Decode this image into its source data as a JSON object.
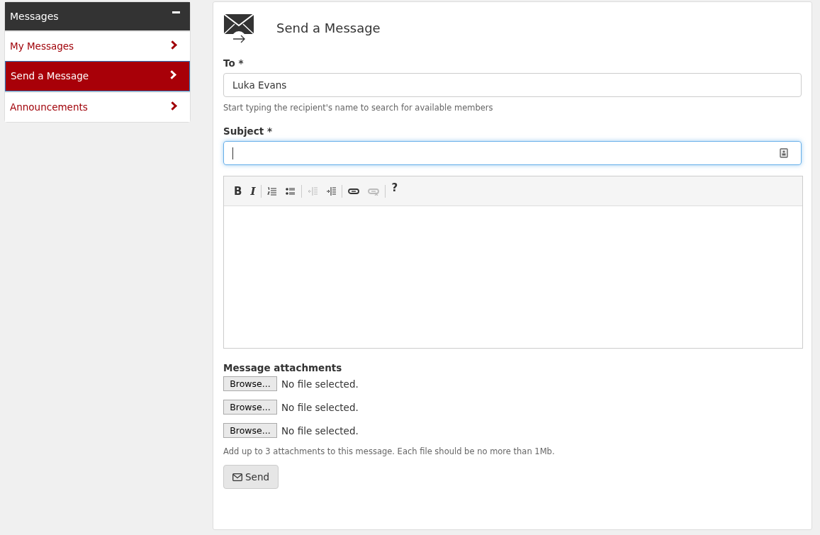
{
  "sidebar": {
    "title": "Messages",
    "expanded": true,
    "items": [
      {
        "label": "My Messages",
        "selected": false
      },
      {
        "label": "Send a Message",
        "selected": true
      },
      {
        "label": "Announcements",
        "selected": false
      }
    ]
  },
  "form": {
    "title": "Send a Message",
    "to": {
      "label": "To *",
      "value": "Luka Evans",
      "help": "Start typing the recipient's name to search for available members"
    },
    "subject": {
      "label": "Subject *",
      "focused": true
    },
    "toolbar": [
      {
        "kind": "bold",
        "text": "B",
        "disabled": false
      },
      {
        "kind": "italic",
        "text": "I",
        "disabled": false
      },
      {
        "kind": "ordered-list",
        "disabled": false
      },
      {
        "kind": "bullet-list",
        "disabled": false
      },
      {
        "kind": "outdent",
        "disabled": true
      },
      {
        "kind": "indent",
        "disabled": false
      },
      {
        "kind": "link",
        "disabled": false
      },
      {
        "kind": "unlink",
        "disabled": true
      },
      {
        "kind": "help",
        "text": "?",
        "disabled": false
      }
    ],
    "attachments": {
      "label": "Message attachments",
      "files": [
        {
          "button": "Browse...",
          "status": "No file selected."
        },
        {
          "button": "Browse...",
          "status": "No file selected."
        },
        {
          "button": "Browse...",
          "status": "No file selected."
        }
      ],
      "help": "Add up to 3 attachments to this message. Each file should be no more than 1Mb."
    },
    "send": "Send"
  }
}
